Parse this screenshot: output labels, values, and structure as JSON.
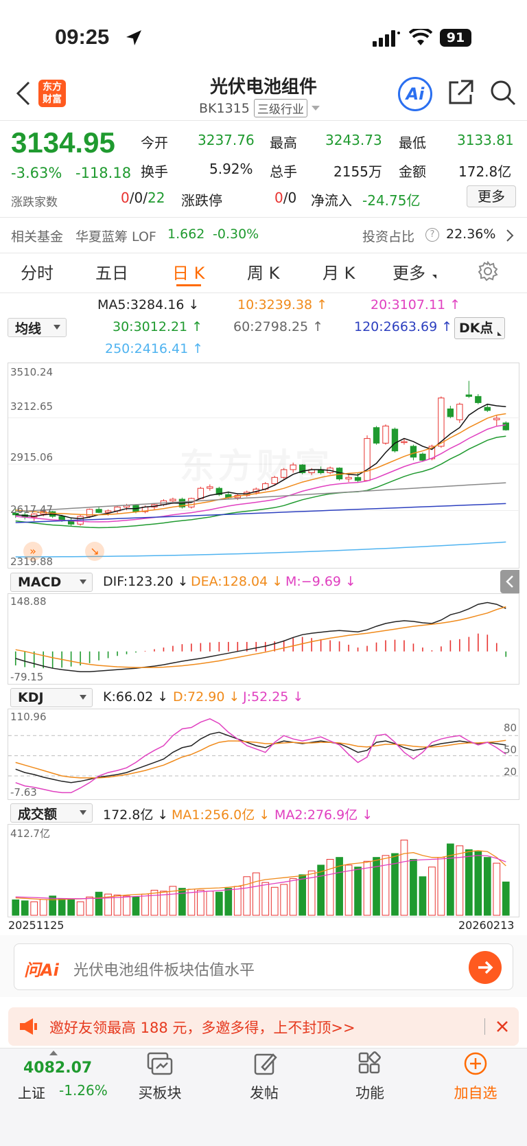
{
  "status_bar": {
    "time": "09:25",
    "battery": "91"
  },
  "header": {
    "logo_line1": "东方",
    "logo_line2": "财富",
    "title": "光伏电池组件",
    "code": "BK1315",
    "tag": "三级行业",
    "ai_label": "Ai"
  },
  "quote": {
    "price": "3134.95",
    "change_pct": "-3.63%",
    "change": "-118.18",
    "open_label": "今开",
    "open": "3237.76",
    "high_label": "最高",
    "high": "3243.73",
    "low_label": "最低",
    "low": "3133.81",
    "turnover_label": "换手",
    "turnover": "5.92%",
    "volume_label": "总手",
    "volume": "2155万",
    "amount_label": "金额",
    "amount": "172.8亿",
    "updown_label": "涨跌家数",
    "up": "0",
    "flat": "0",
    "down": "22",
    "limit_label": "涨跌停",
    "limit_up": "0",
    "limit_down": "0",
    "netflow_label": "净流入",
    "netflow": "-24.75亿",
    "more_button": "更多"
  },
  "fund": {
    "label": "相关基金",
    "name": "华夏蓝筹 LOF",
    "price": "1.662",
    "change": "-0.30%",
    "ratio_label": "投资占比",
    "ratio": "22.36%"
  },
  "tabs": [
    "分时",
    "五日",
    "日 K",
    "周 K",
    "月 K",
    "更多"
  ],
  "active_tab": "日 K",
  "ma_legend": {
    "selector": "均线",
    "ma5": "MA5:3284.16 ↓",
    "ma10": "10:3239.38 ↑",
    "ma20": "20:3107.11 ↑",
    "ma30": "30:3012.21 ↑",
    "ma60": "60:2798.25 ↑",
    "ma120": "120:2663.69 ↑",
    "ma250": "250:2416.41 ↑",
    "dk_button": "DK点"
  },
  "kline_axis": {
    "y1": "3510.24",
    "y2": "3212.65",
    "y3": "2915.06",
    "y4": "2617.47",
    "y5": "2319.88"
  },
  "watermark": "东方财富",
  "macd": {
    "selector": "MACD",
    "dif": "DIF:123.20 ↓",
    "dea": "DEA:128.04 ↓",
    "m": "M:−9.69 ↓",
    "y_top": "148.88",
    "y_bottom": "-79.15"
  },
  "kdj": {
    "selector": "KDJ",
    "k": "K:66.02 ↓",
    "d": "D:72.90 ↓",
    "j": "J:52.25 ↓",
    "y_top": "110.96",
    "y_bottom": "-7.63",
    "level80": "80",
    "level50": "50",
    "level20": "20"
  },
  "volume": {
    "selector": "成交额",
    "value": "172.8亿 ↓",
    "ma1": "MA1:256.0亿 ↓",
    "ma2": "MA2:276.9亿 ↓",
    "y_top": "412.7亿"
  },
  "dates": {
    "start": "20251125",
    "end": "20260213"
  },
  "ask_ai": {
    "logo": "问Ai",
    "placeholder": "光伏电池组件板块估值水平"
  },
  "promo": {
    "text": "邀好友领最高 188 元，多邀多得，上不封顶>>"
  },
  "bottom_nav": {
    "index_value": "4082.07",
    "index_name": "上证",
    "index_change": "-1.26%",
    "buy_block": "买板块",
    "post": "发帖",
    "functions": "功能",
    "add_watch": "加自选"
  },
  "colors": {
    "up": "#e8322f",
    "down": "#1f9a2f",
    "accent": "#ff6a00"
  },
  "chart_data": [
    {
      "type": "candlestick",
      "title": "日 K",
      "ylim": [
        2319.88,
        3510.24
      ],
      "y_ticks": [
        3510.24,
        3212.65,
        2915.06,
        2617.47,
        2319.88
      ],
      "x_range": [
        "20251125",
        "20260213"
      ],
      "candles": [
        {
          "o": 2600,
          "h": 2630,
          "l": 2570,
          "c": 2590
        },
        {
          "o": 2590,
          "h": 2610,
          "l": 2560,
          "c": 2575
        },
        {
          "o": 2575,
          "h": 2600,
          "l": 2550,
          "c": 2595
        },
        {
          "o": 2595,
          "h": 2625,
          "l": 2580,
          "c": 2610
        },
        {
          "o": 2610,
          "h": 2615,
          "l": 2570,
          "c": 2580
        },
        {
          "o": 2580,
          "h": 2590,
          "l": 2545,
          "c": 2555
        },
        {
          "o": 2555,
          "h": 2570,
          "l": 2520,
          "c": 2530
        },
        {
          "o": 2530,
          "h": 2590,
          "l": 2520,
          "c": 2580
        },
        {
          "o": 2580,
          "h": 2630,
          "l": 2570,
          "c": 2625
        },
        {
          "o": 2625,
          "h": 2640,
          "l": 2600,
          "c": 2605
        },
        {
          "o": 2605,
          "h": 2625,
          "l": 2585,
          "c": 2615
        },
        {
          "o": 2615,
          "h": 2645,
          "l": 2600,
          "c": 2640
        },
        {
          "o": 2640,
          "h": 2660,
          "l": 2620,
          "c": 2650
        },
        {
          "o": 2650,
          "h": 2655,
          "l": 2600,
          "c": 2610
        },
        {
          "o": 2610,
          "h": 2650,
          "l": 2600,
          "c": 2640
        },
        {
          "o": 2640,
          "h": 2660,
          "l": 2620,
          "c": 2655
        },
        {
          "o": 2655,
          "h": 2690,
          "l": 2645,
          "c": 2680
        },
        {
          "o": 2680,
          "h": 2700,
          "l": 2660,
          "c": 2690
        },
        {
          "o": 2690,
          "h": 2700,
          "l": 2630,
          "c": 2640
        },
        {
          "o": 2640,
          "h": 2700,
          "l": 2630,
          "c": 2695
        },
        {
          "o": 2695,
          "h": 2770,
          "l": 2690,
          "c": 2760
        },
        {
          "o": 2760,
          "h": 2785,
          "l": 2745,
          "c": 2770
        },
        {
          "o": 2760,
          "h": 2770,
          "l": 2710,
          "c": 2720
        },
        {
          "o": 2720,
          "h": 2740,
          "l": 2690,
          "c": 2700
        },
        {
          "o": 2700,
          "h": 2725,
          "l": 2685,
          "c": 2715
        },
        {
          "o": 2715,
          "h": 2745,
          "l": 2705,
          "c": 2735
        },
        {
          "o": 2735,
          "h": 2765,
          "l": 2720,
          "c": 2755
        },
        {
          "o": 2755,
          "h": 2800,
          "l": 2745,
          "c": 2790
        },
        {
          "o": 2790,
          "h": 2840,
          "l": 2780,
          "c": 2830
        },
        {
          "o": 2830,
          "h": 2890,
          "l": 2820,
          "c": 2880
        },
        {
          "o": 2880,
          "h": 2925,
          "l": 2860,
          "c": 2910
        },
        {
          "o": 2910,
          "h": 2915,
          "l": 2850,
          "c": 2860
        },
        {
          "o": 2860,
          "h": 2890,
          "l": 2845,
          "c": 2880
        },
        {
          "o": 2880,
          "h": 2900,
          "l": 2850,
          "c": 2860
        },
        {
          "o": 2860,
          "h": 2900,
          "l": 2850,
          "c": 2890
        },
        {
          "o": 2890,
          "h": 2895,
          "l": 2810,
          "c": 2820
        },
        {
          "o": 2820,
          "h": 2850,
          "l": 2800,
          "c": 2830
        },
        {
          "o": 2830,
          "h": 2860,
          "l": 2800,
          "c": 2810
        },
        {
          "o": 2810,
          "h": 3100,
          "l": 2805,
          "c": 3080
        },
        {
          "o": 3150,
          "h": 3160,
          "l": 3040,
          "c": 3050
        },
        {
          "o": 3050,
          "h": 3170,
          "l": 3040,
          "c": 3160
        },
        {
          "o": 3140,
          "h": 3150,
          "l": 2990,
          "c": 3000
        },
        {
          "o": 3060,
          "h": 3080,
          "l": 3040,
          "c": 3060
        },
        {
          "o": 3030,
          "h": 3040,
          "l": 2940,
          "c": 2960
        },
        {
          "o": 2980,
          "h": 2990,
          "l": 2930,
          "c": 2940
        },
        {
          "o": 2950,
          "h": 3040,
          "l": 2940,
          "c": 3030
        },
        {
          "o": 3030,
          "h": 3350,
          "l": 3020,
          "c": 3340
        },
        {
          "o": 3270,
          "h": 3290,
          "l": 3210,
          "c": 3220
        },
        {
          "o": 3200,
          "h": 3310,
          "l": 3180,
          "c": 3300
        },
        {
          "o": 3360,
          "h": 3450,
          "l": 3340,
          "c": 3350
        },
        {
          "o": 3350,
          "h": 3365,
          "l": 3300,
          "c": 3310
        },
        {
          "o": 3280,
          "h": 3300,
          "l": 3250,
          "c": 3260
        },
        {
          "o": 3200,
          "h": 3230,
          "l": 3160,
          "c": 3210
        },
        {
          "o": 3180,
          "h": 3190,
          "l": 3130,
          "c": 3135
        }
      ],
      "series": [
        {
          "name": "MA5",
          "values": [
            2590,
            2585,
            2580,
            2590,
            2595,
            2585,
            2570,
            2565,
            2575,
            2590,
            2600,
            2615,
            2630,
            2630,
            2640,
            2645,
            2655,
            2665,
            2665,
            2670,
            2695,
            2715,
            2725,
            2735,
            2725,
            2725,
            2740,
            2755,
            2780,
            2815,
            2850,
            2870,
            2880,
            2880,
            2875,
            2860,
            2850,
            2845,
            2880,
            2920,
            2990,
            3050,
            3080,
            3060,
            3030,
            3010,
            3060,
            3110,
            3150,
            3230,
            3270,
            3300,
            3290,
            3284
          ]
        },
        {
          "name": "MA10",
          "values": [
            2620,
            2615,
            2610,
            2605,
            2600,
            2598,
            2595,
            2592,
            2590,
            2590,
            2592,
            2596,
            2602,
            2608,
            2615,
            2622,
            2630,
            2640,
            2648,
            2655,
            2665,
            2675,
            2688,
            2700,
            2710,
            2718,
            2726,
            2735,
            2745,
            2760,
            2780,
            2800,
            2815,
            2830,
            2842,
            2850,
            2856,
            2860,
            2870,
            2890,
            2915,
            2940,
            2965,
            2985,
            3000,
            3020,
            3050,
            3085,
            3115,
            3150,
            3180,
            3210,
            3230,
            3239
          ]
        }
      ]
    },
    {
      "type": "line",
      "title": "MACD",
      "ylim": [
        -79.15,
        148.88
      ],
      "series": [
        {
          "name": "DIF",
          "values": [
            -20,
            -28,
            -35,
            -42,
            -48,
            -52,
            -55,
            -58,
            -58,
            -56,
            -54,
            -52,
            -50,
            -48,
            -45,
            -42,
            -38,
            -33,
            -28,
            -24,
            -20,
            -15,
            -10,
            -5,
            0,
            5,
            10,
            15,
            22,
            30,
            40,
            48,
            52,
            55,
            58,
            60,
            58,
            56,
            62,
            72,
            80,
            85,
            88,
            86,
            82,
            80,
            90,
            105,
            112,
            122,
            135,
            140,
            135,
            123
          ]
        },
        {
          "name": "DEA",
          "values": [
            5,
            0,
            -6,
            -12,
            -18,
            -23,
            -28,
            -33,
            -37,
            -40,
            -42,
            -44,
            -45,
            -46,
            -46,
            -46,
            -45,
            -43,
            -41,
            -38,
            -35,
            -31,
            -27,
            -22,
            -17,
            -12,
            -7,
            -2,
            4,
            10,
            16,
            22,
            28,
            33,
            38,
            42,
            46,
            49,
            52,
            56,
            60,
            64,
            68,
            72,
            75,
            78,
            81,
            85,
            90,
            96,
            103,
            110,
            120,
            128
          ]
        },
        {
          "name": "M",
          "values": [
            -25,
            -28,
            -29,
            -30,
            -30,
            -29,
            -27,
            -25,
            -21,
            -16,
            -12,
            -8,
            -5,
            -2,
            1,
            4,
            7,
            10,
            13,
            14,
            15,
            16,
            17,
            17,
            17,
            17,
            17,
            17,
            18,
            20,
            24,
            26,
            24,
            22,
            20,
            18,
            12,
            7,
            10,
            16,
            20,
            21,
            20,
            14,
            7,
            2,
            9,
            20,
            22,
            26,
            32,
            30,
            15,
            -9.69
          ]
        }
      ]
    },
    {
      "type": "line",
      "title": "KDJ",
      "ylim": [
        -7.63,
        110.96
      ],
      "series": [
        {
          "name": "K",
          "values": [
            30,
            25,
            22,
            18,
            15,
            12,
            10,
            12,
            15,
            18,
            20,
            22,
            25,
            30,
            35,
            40,
            45,
            55,
            62,
            65,
            75,
            82,
            85,
            80,
            75,
            70,
            65,
            62,
            68,
            72,
            70,
            68,
            70,
            72,
            70,
            68,
            62,
            55,
            58,
            70,
            72,
            68,
            62,
            58,
            60,
            65,
            68,
            70,
            72,
            70,
            68,
            70,
            68,
            66
          ]
        },
        {
          "name": "D",
          "values": [
            40,
            36,
            32,
            28,
            24,
            20,
            18,
            17,
            17,
            17,
            18,
            20,
            22,
            25,
            28,
            32,
            36,
            42,
            48,
            52,
            58,
            65,
            70,
            72,
            72,
            71,
            70,
            68,
            68,
            69,
            70,
            69,
            69,
            70,
            70,
            69,
            67,
            64,
            63,
            65,
            67,
            67,
            66,
            64,
            63,
            63,
            64,
            66,
            68,
            69,
            69,
            70,
            71,
            72.9
          ]
        },
        {
          "name": "J",
          "values": [
            10,
            5,
            3,
            0,
            -3,
            -5,
            -5,
            2,
            10,
            20,
            25,
            28,
            32,
            40,
            50,
            58,
            65,
            80,
            90,
            92,
            100,
            105,
            98,
            85,
            75,
            65,
            60,
            55,
            70,
            80,
            75,
            72,
            75,
            78,
            72,
            66,
            52,
            40,
            48,
            80,
            82,
            70,
            55,
            45,
            55,
            70,
            75,
            78,
            80,
            72,
            66,
            70,
            62,
            52.25
          ]
        }
      ]
    },
    {
      "type": "bar",
      "title": "成交额",
      "ylim": [
        0,
        412.7
      ],
      "unit": "亿",
      "values": [
        80,
        75,
        70,
        82,
        100,
        85,
        80,
        70,
        95,
        120,
        110,
        105,
        100,
        95,
        110,
        130,
        125,
        150,
        140,
        135,
        130,
        125,
        120,
        140,
        150,
        200,
        220,
        170,
        145,
        160,
        190,
        210,
        230,
        260,
        290,
        300,
        260,
        250,
        280,
        300,
        310,
        320,
        390,
        290,
        200,
        250,
        300,
        370,
        360,
        340,
        330,
        300,
        270,
        172.8
      ],
      "series": [
        {
          "name": "MA1",
          "values": [
            90,
            88,
            85,
            82,
            80,
            82,
            84,
            85,
            88,
            90,
            95,
            100,
            105,
            108,
            110,
            115,
            120,
            125,
            130,
            135,
            138,
            140,
            142,
            145,
            150,
            160,
            175,
            185,
            190,
            195,
            200,
            205,
            215,
            225,
            240,
            255,
            265,
            270,
            275,
            285,
            295,
            305,
            320,
            325,
            310,
            300,
            300,
            310,
            320,
            330,
            335,
            330,
            300,
            256
          ]
        },
        {
          "name": "MA2",
          "values": [
            95,
            94,
            92,
            90,
            88,
            87,
            86,
            86,
            87,
            88,
            90,
            92,
            95,
            98,
            100,
            103,
            106,
            110,
            114,
            118,
            122,
            125,
            128,
            132,
            136,
            142,
            150,
            158,
            165,
            172,
            180,
            188,
            195,
            203,
            212,
            222,
            230,
            238,
            245,
            252,
            260,
            268,
            278,
            285,
            288,
            290,
            292,
            296,
            300,
            305,
            310,
            308,
            295,
            276.9
          ]
        }
      ]
    }
  ]
}
